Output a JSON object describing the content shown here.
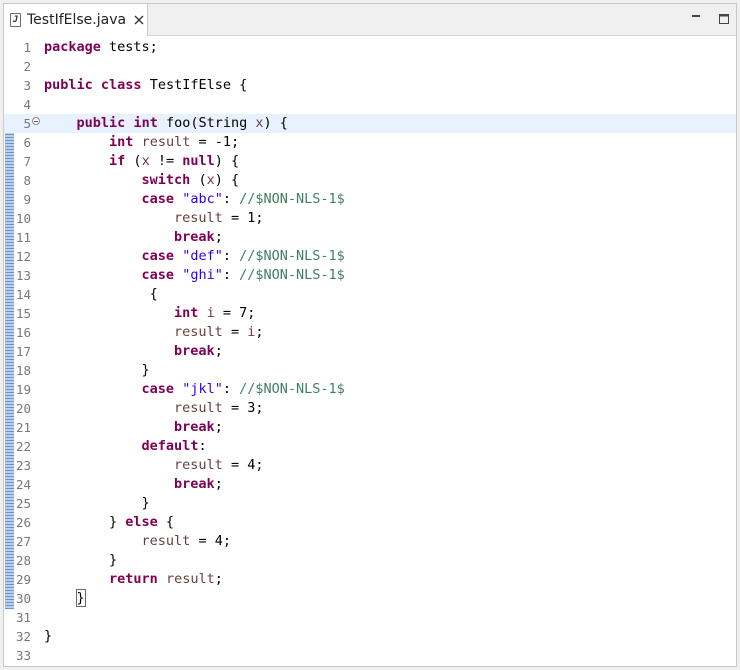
{
  "editor": {
    "tab": {
      "filename": "TestIfElse.java",
      "icon": "java-file-icon",
      "close_icon": "close-icon"
    },
    "window_controls": {
      "minimize_icon": "minimize-icon",
      "maximize_icon": "maximize-icon"
    },
    "current_line": 5,
    "colors": {
      "keyword": "#7f0055",
      "string": "#2a00ff",
      "comment": "#3f7f5f",
      "variable": "#6a3e3e",
      "line_number": "#787878",
      "current_line_bg": "#e8f2fe",
      "change_bar": "#6f96cc"
    }
  },
  "lines": [
    {
      "n": "1",
      "code": "package tests;"
    },
    {
      "n": "2",
      "code": ""
    },
    {
      "n": "3",
      "code": "public class TestIfElse {"
    },
    {
      "n": "4",
      "code": ""
    },
    {
      "n": "5",
      "code": "    public int foo(String x) {"
    },
    {
      "n": "6",
      "code": "        int result = -1;"
    },
    {
      "n": "7",
      "code": "        if (x != null) {"
    },
    {
      "n": "8",
      "code": "            switch (x) {"
    },
    {
      "n": "9",
      "code": "            case \"abc\": //$NON-NLS-1$"
    },
    {
      "n": "10",
      "code": "                result = 1;"
    },
    {
      "n": "11",
      "code": "                break;"
    },
    {
      "n": "12",
      "code": "            case \"def\": //$NON-NLS-1$"
    },
    {
      "n": "13",
      "code": "            case \"ghi\": //$NON-NLS-1$"
    },
    {
      "n": "14",
      "code": "             {"
    },
    {
      "n": "15",
      "code": "                int i = 7;"
    },
    {
      "n": "16",
      "code": "                result = i;"
    },
    {
      "n": "17",
      "code": "                break;"
    },
    {
      "n": "18",
      "code": "            }"
    },
    {
      "n": "19",
      "code": "            case \"jkl\": //$NON-NLS-1$"
    },
    {
      "n": "20",
      "code": "                result = 3;"
    },
    {
      "n": "21",
      "code": "                break;"
    },
    {
      "n": "22",
      "code": "            default:"
    },
    {
      "n": "23",
      "code": "                result = 4;"
    },
    {
      "n": "24",
      "code": "                break;"
    },
    {
      "n": "25",
      "code": "            }"
    },
    {
      "n": "26",
      "code": "        } else {"
    },
    {
      "n": "27",
      "code": "            result = 4;"
    },
    {
      "n": "28",
      "code": "        }"
    },
    {
      "n": "29",
      "code": "        return result;"
    },
    {
      "n": "30",
      "code": "    }"
    },
    {
      "n": "31",
      "code": ""
    },
    {
      "n": "32",
      "code": "}"
    },
    {
      "n": "33",
      "code": ""
    }
  ]
}
